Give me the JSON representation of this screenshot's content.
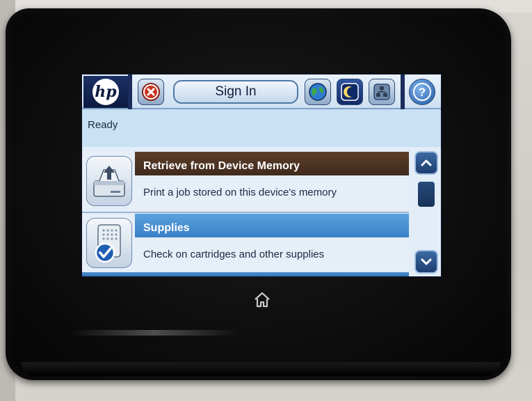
{
  "topbar": {
    "logo_text": "hp",
    "signin_label": "Sign In",
    "icons": [
      "stop-icon",
      "globe-icon",
      "sleep-moon-icon",
      "network-icon",
      "help-icon"
    ]
  },
  "status": {
    "text": "Ready"
  },
  "list": {
    "items": [
      {
        "title": "Retrieve from Device Memory",
        "description": "Print a job stored on this device's memory",
        "icon": "device-memory-icon"
      },
      {
        "title": "Supplies",
        "description": "Check on cartridges and other supplies",
        "icon": "supplies-icon"
      }
    ]
  },
  "scrollbar": {
    "up_icon": "chevron-up-icon",
    "down_icon": "chevron-down-icon"
  },
  "device": {
    "home_icon": "home-icon"
  },
  "colors": {
    "screen_bg": "#c9e1f4",
    "header_navy": "#1c3165",
    "item1_title_bg": "#4e3423",
    "item2_title_bg": "#3a80c6",
    "bezel": "#0d0d0e"
  }
}
